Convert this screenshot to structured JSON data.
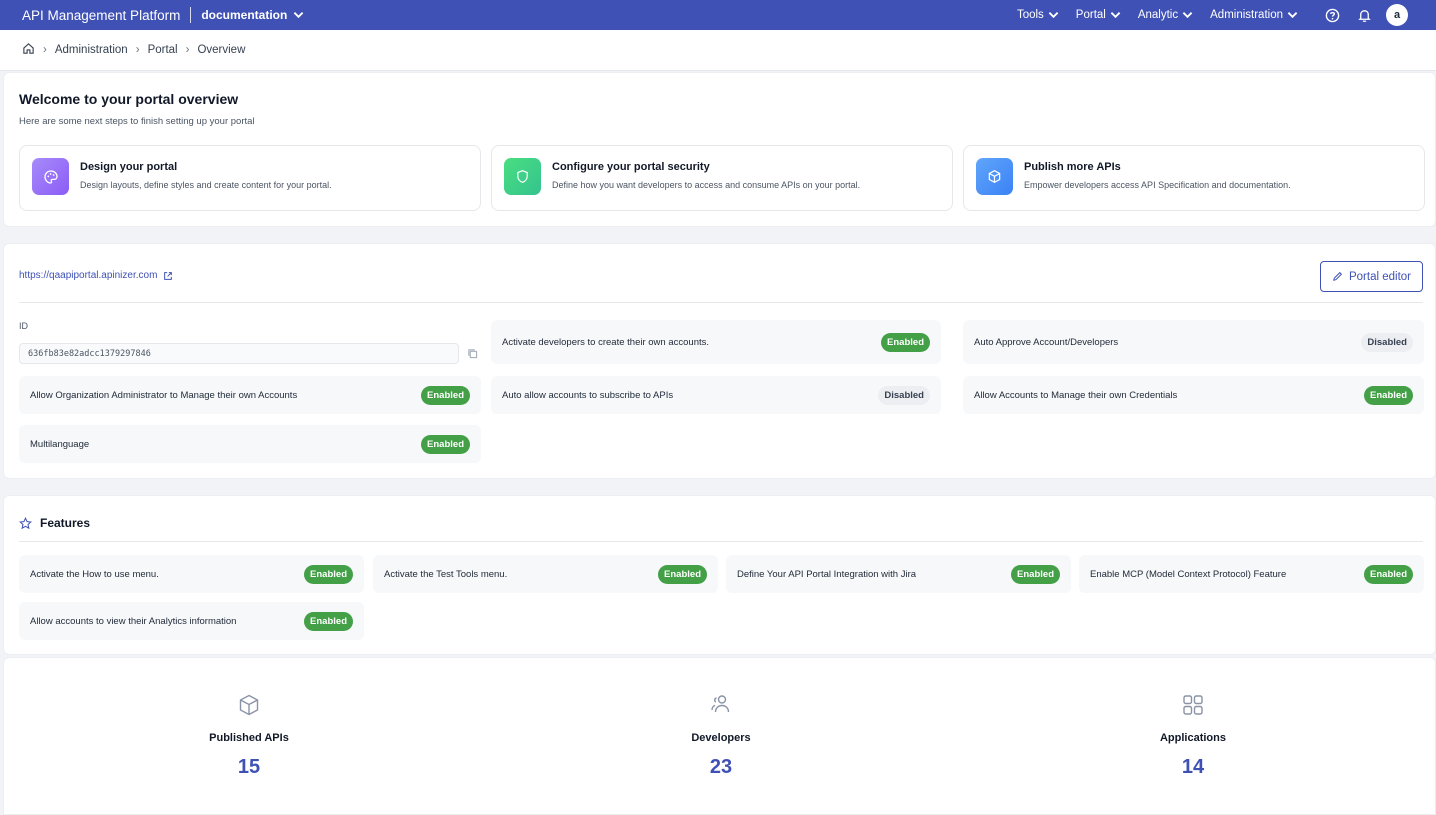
{
  "topbar": {
    "app_title": "API Management Platform",
    "workspace": "documentation",
    "nav": [
      {
        "label": "Tools"
      },
      {
        "label": "Portal"
      },
      {
        "label": "Analytic"
      },
      {
        "label": "Administration"
      }
    ],
    "avatar_letter": "a",
    "icons": [
      "help-circle-icon",
      "bell-icon"
    ]
  },
  "breadcrumb": [
    "Administration",
    "Portal",
    "Overview"
  ],
  "welcome": {
    "title": "Welcome to your portal overview",
    "subtitle": "Here are some next steps to finish setting up your portal",
    "cards": [
      {
        "title": "Design your portal",
        "desc": "Design layouts, define styles and create content for your portal.",
        "icon": "palette-icon",
        "color": "#8b5cf6"
      },
      {
        "title": "Configure your portal security",
        "desc": "Define how you want developers to access and consume APIs on your portal.",
        "icon": "shield-icon",
        "color": "#34c38f"
      },
      {
        "title": "Publish more APIs",
        "desc": "Empower developers access API Specification and documentation.",
        "icon": "cube-icon",
        "color": "#3b82f6"
      }
    ]
  },
  "portal": {
    "url": "https://qaapiportal.apinizer.com",
    "editor_label": "Portal editor",
    "id_label": "ID",
    "id_value": "636fb83e82adcc1379297846",
    "settings": [
      {
        "label": "Activate developers to create their own accounts.",
        "status": "Enabled"
      },
      {
        "label": "Auto Approve Account/Developers",
        "status": "Disabled"
      },
      {
        "label": "Allow Organization Administrator to Manage their own Accounts",
        "status": "Enabled"
      },
      {
        "label": "Auto allow accounts to subscribe to APIs",
        "status": "Disabled"
      },
      {
        "label": "Allow Accounts to Manage their own Credentials",
        "status": "Enabled"
      },
      {
        "label": "Multilanguage",
        "status": "Enabled"
      }
    ]
  },
  "features": {
    "title": "Features",
    "items": [
      {
        "label": "Activate the How to use menu.",
        "status": "Enabled"
      },
      {
        "label": "Activate the Test Tools menu.",
        "status": "Enabled"
      },
      {
        "label": "Define Your API Portal Integration with Jira",
        "status": "Enabled"
      },
      {
        "label": "Enable MCP (Model Context Protocol) Feature",
        "status": "Enabled"
      },
      {
        "label": "Allow accounts to view their Analytics information",
        "status": "Enabled"
      }
    ]
  },
  "stats": [
    {
      "label": "Published APIs",
      "value": "15",
      "icon": "cube-icon"
    },
    {
      "label": "Developers",
      "value": "23",
      "icon": "users-icon"
    },
    {
      "label": "Applications",
      "value": "14",
      "icon": "grid-icon"
    }
  ],
  "colors": {
    "primary": "#3f51b5",
    "enabled": "#43a047",
    "disabled_bg": "#eceef2"
  }
}
